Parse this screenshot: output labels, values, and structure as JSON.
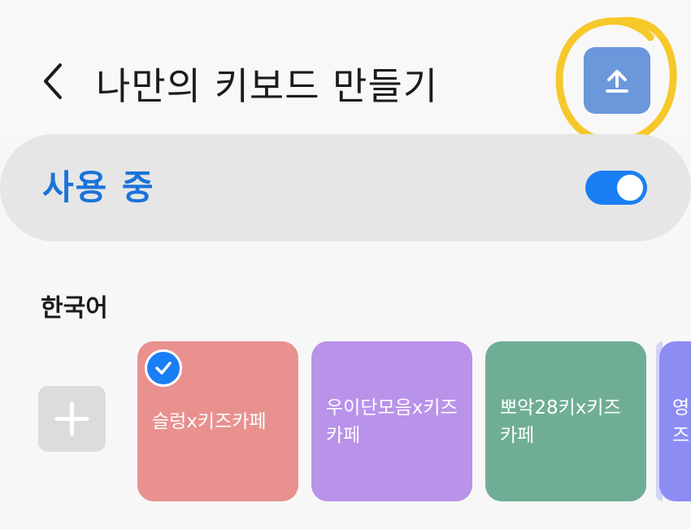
{
  "header": {
    "title": "나만의 키보드 만들기",
    "back_icon": "chevron-left-icon",
    "upload_icon": "upload-icon"
  },
  "status": {
    "label": "사용 중",
    "enabled": true
  },
  "language_section": {
    "label": "한국어"
  },
  "keyboards": [
    {
      "label": "슬렁x키즈카페",
      "selected": true,
      "color": "#e8918f"
    },
    {
      "label": "우이단모음x키즈카페",
      "selected": false,
      "color": "#b992ea"
    },
    {
      "label": "뽀악28키x키즈카페",
      "selected": false,
      "color": "#6fae95"
    },
    {
      "label": "영\n즈",
      "selected": false,
      "color": "#8c8cf3"
    }
  ],
  "colors": {
    "accent": "#1a7ef5",
    "upload_button": "#6b97db",
    "highlight_annotation": "#f7c82a"
  }
}
